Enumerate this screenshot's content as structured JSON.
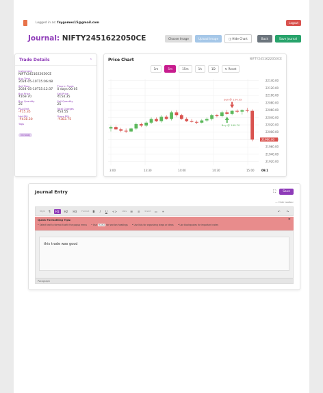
{
  "header": {
    "logged_prefix": "Logged in as:",
    "email": "faygomes15@gmail.com",
    "logout_label": "Logout"
  },
  "title": {
    "prefix": "Journal:",
    "symbol": "NIFTY2451622050CE"
  },
  "buttons": {
    "choose_image": "Choose Image",
    "upload_image": "Upload Image",
    "hide_chart": "Hide Chart",
    "back": "Back",
    "save_journal": "Save Journal"
  },
  "trade_details": {
    "title": "Trade Details",
    "instrument_label": "Instrument",
    "instrument": "NIFTY2451622050CE",
    "buy_time_label": "Buy Time",
    "buy_time": "2024-05-10T15:06:48",
    "sell_time_label": "Sell Time",
    "sell_time": "2024-05-10T15:12:37",
    "time_in_trade_label": "Time in Trade",
    "time_in_trade": "0 days 00:05",
    "buy_price_label": "Buy Price",
    "buy_price": "₹169.70",
    "sell_price_label": "Sell Price",
    "sell_price": "₹154.35",
    "buy_qty_label": "Buy Quantity",
    "buy_qty": "25",
    "sell_qty_label": "Sell Quantity",
    "sell_qty": "25",
    "pl_unit_label": "P&L/Unit",
    "pl_unit": "-₹15.35",
    "charges_label": "Total Charges",
    "charges": "₹54.55",
    "net_pl_label": "Net P&L",
    "net_pl": "-₹438.30",
    "gross_pl_label": "Gross P&L",
    "gross_pl": "-₹383.75",
    "tags_label": "Tags",
    "tag": "Intraday"
  },
  "price_chart": {
    "title": "Price Chart",
    "symbol": "NIFTY2451622050CE",
    "timeframes": [
      "1m",
      "5m",
      "15m",
      "1h",
      "1D"
    ],
    "active_timeframe": "5m",
    "reset_label": "Reset",
    "sell_annotation": "Sell @ 154.35",
    "buy_annotation": "Buy @ 169.70",
    "price_tag": "21960.00",
    "time_partial": "09:1"
  },
  "chart_data": {
    "type": "candlestick",
    "x_ticks": [
      "3:00",
      "13:30",
      "14:00",
      "14:30",
      "15:00"
    ],
    "y_ticks": [
      22140,
      22120,
      22100,
      22080,
      22060,
      22040,
      22020,
      22000,
      21980,
      21960,
      21940,
      21920
    ],
    "ylim": [
      21910,
      22145
    ],
    "up_color": "#5cb85c",
    "down_color": "#d9534f",
    "candles": [
      {
        "o": 22010,
        "h": 22018,
        "l": 22002,
        "c": 22014
      },
      {
        "o": 22014,
        "h": 22018,
        "l": 22006,
        "c": 22008
      },
      {
        "o": 22008,
        "h": 22012,
        "l": 22000,
        "c": 22004
      },
      {
        "o": 22004,
        "h": 22010,
        "l": 21998,
        "c": 22002
      },
      {
        "o": 22002,
        "h": 22012,
        "l": 22000,
        "c": 22010
      },
      {
        "o": 22010,
        "h": 22026,
        "l": 22006,
        "c": 22022
      },
      {
        "o": 22022,
        "h": 22026,
        "l": 22014,
        "c": 22018
      },
      {
        "o": 22018,
        "h": 22030,
        "l": 22014,
        "c": 22026
      },
      {
        "o": 22026,
        "h": 22040,
        "l": 22022,
        "c": 22036
      },
      {
        "o": 22036,
        "h": 22040,
        "l": 22028,
        "c": 22030
      },
      {
        "o": 22030,
        "h": 22046,
        "l": 22026,
        "c": 22042
      },
      {
        "o": 22042,
        "h": 22046,
        "l": 22034,
        "c": 22036
      },
      {
        "o": 22036,
        "h": 22058,
        "l": 22032,
        "c": 22054
      },
      {
        "o": 22054,
        "h": 22060,
        "l": 22042,
        "c": 22046
      },
      {
        "o": 22046,
        "h": 22050,
        "l": 22034,
        "c": 22036
      },
      {
        "o": 22036,
        "h": 22040,
        "l": 22028,
        "c": 22030
      },
      {
        "o": 22030,
        "h": 22036,
        "l": 22026,
        "c": 22028
      },
      {
        "o": 22028,
        "h": 22032,
        "l": 22022,
        "c": 22026
      },
      {
        "o": 22026,
        "h": 22036,
        "l": 22024,
        "c": 22032
      },
      {
        "o": 22032,
        "h": 22040,
        "l": 22028,
        "c": 22036
      },
      {
        "o": 22036,
        "h": 22050,
        "l": 22032,
        "c": 22046
      },
      {
        "o": 22046,
        "h": 22050,
        "l": 22040,
        "c": 22044
      },
      {
        "o": 22044,
        "h": 22058,
        "l": 22040,
        "c": 22054
      },
      {
        "o": 22054,
        "h": 22060,
        "l": 22048,
        "c": 22050
      },
      {
        "o": 22050,
        "h": 22060,
        "l": 22046,
        "c": 22058
      },
      {
        "o": 22058,
        "h": 22062,
        "l": 22052,
        "c": 22056
      },
      {
        "o": 22056,
        "h": 22062,
        "l": 22048,
        "c": 22060
      },
      {
        "o": 22060,
        "h": 22066,
        "l": 22054,
        "c": 22058
      },
      {
        "o": 22058,
        "h": 22062,
        "l": 21975,
        "c": 21980
      }
    ]
  },
  "journal_entry": {
    "title": "Journal Entry",
    "save_label": "Save",
    "hide_toolbar": "Hide toolbar",
    "style_label": "Style",
    "format_label": "Format",
    "lists_label": "Lists",
    "insert_label": "Insert",
    "h1": "H1",
    "h2": "H2",
    "h3": "H3",
    "tips_title": "Quick Formatting Tips:",
    "tip1": "• Select text to format it with the popup menu",
    "tip2_prefix": "• Use",
    "tip2_kbd": "H1/H2",
    "tip2_suffix": "for section headings",
    "tip3": "• Use lists for organizing steps or ideas",
    "tip4": "• Use blockquotes for important notes",
    "content": "this trade was good",
    "status": "Paragraph"
  }
}
